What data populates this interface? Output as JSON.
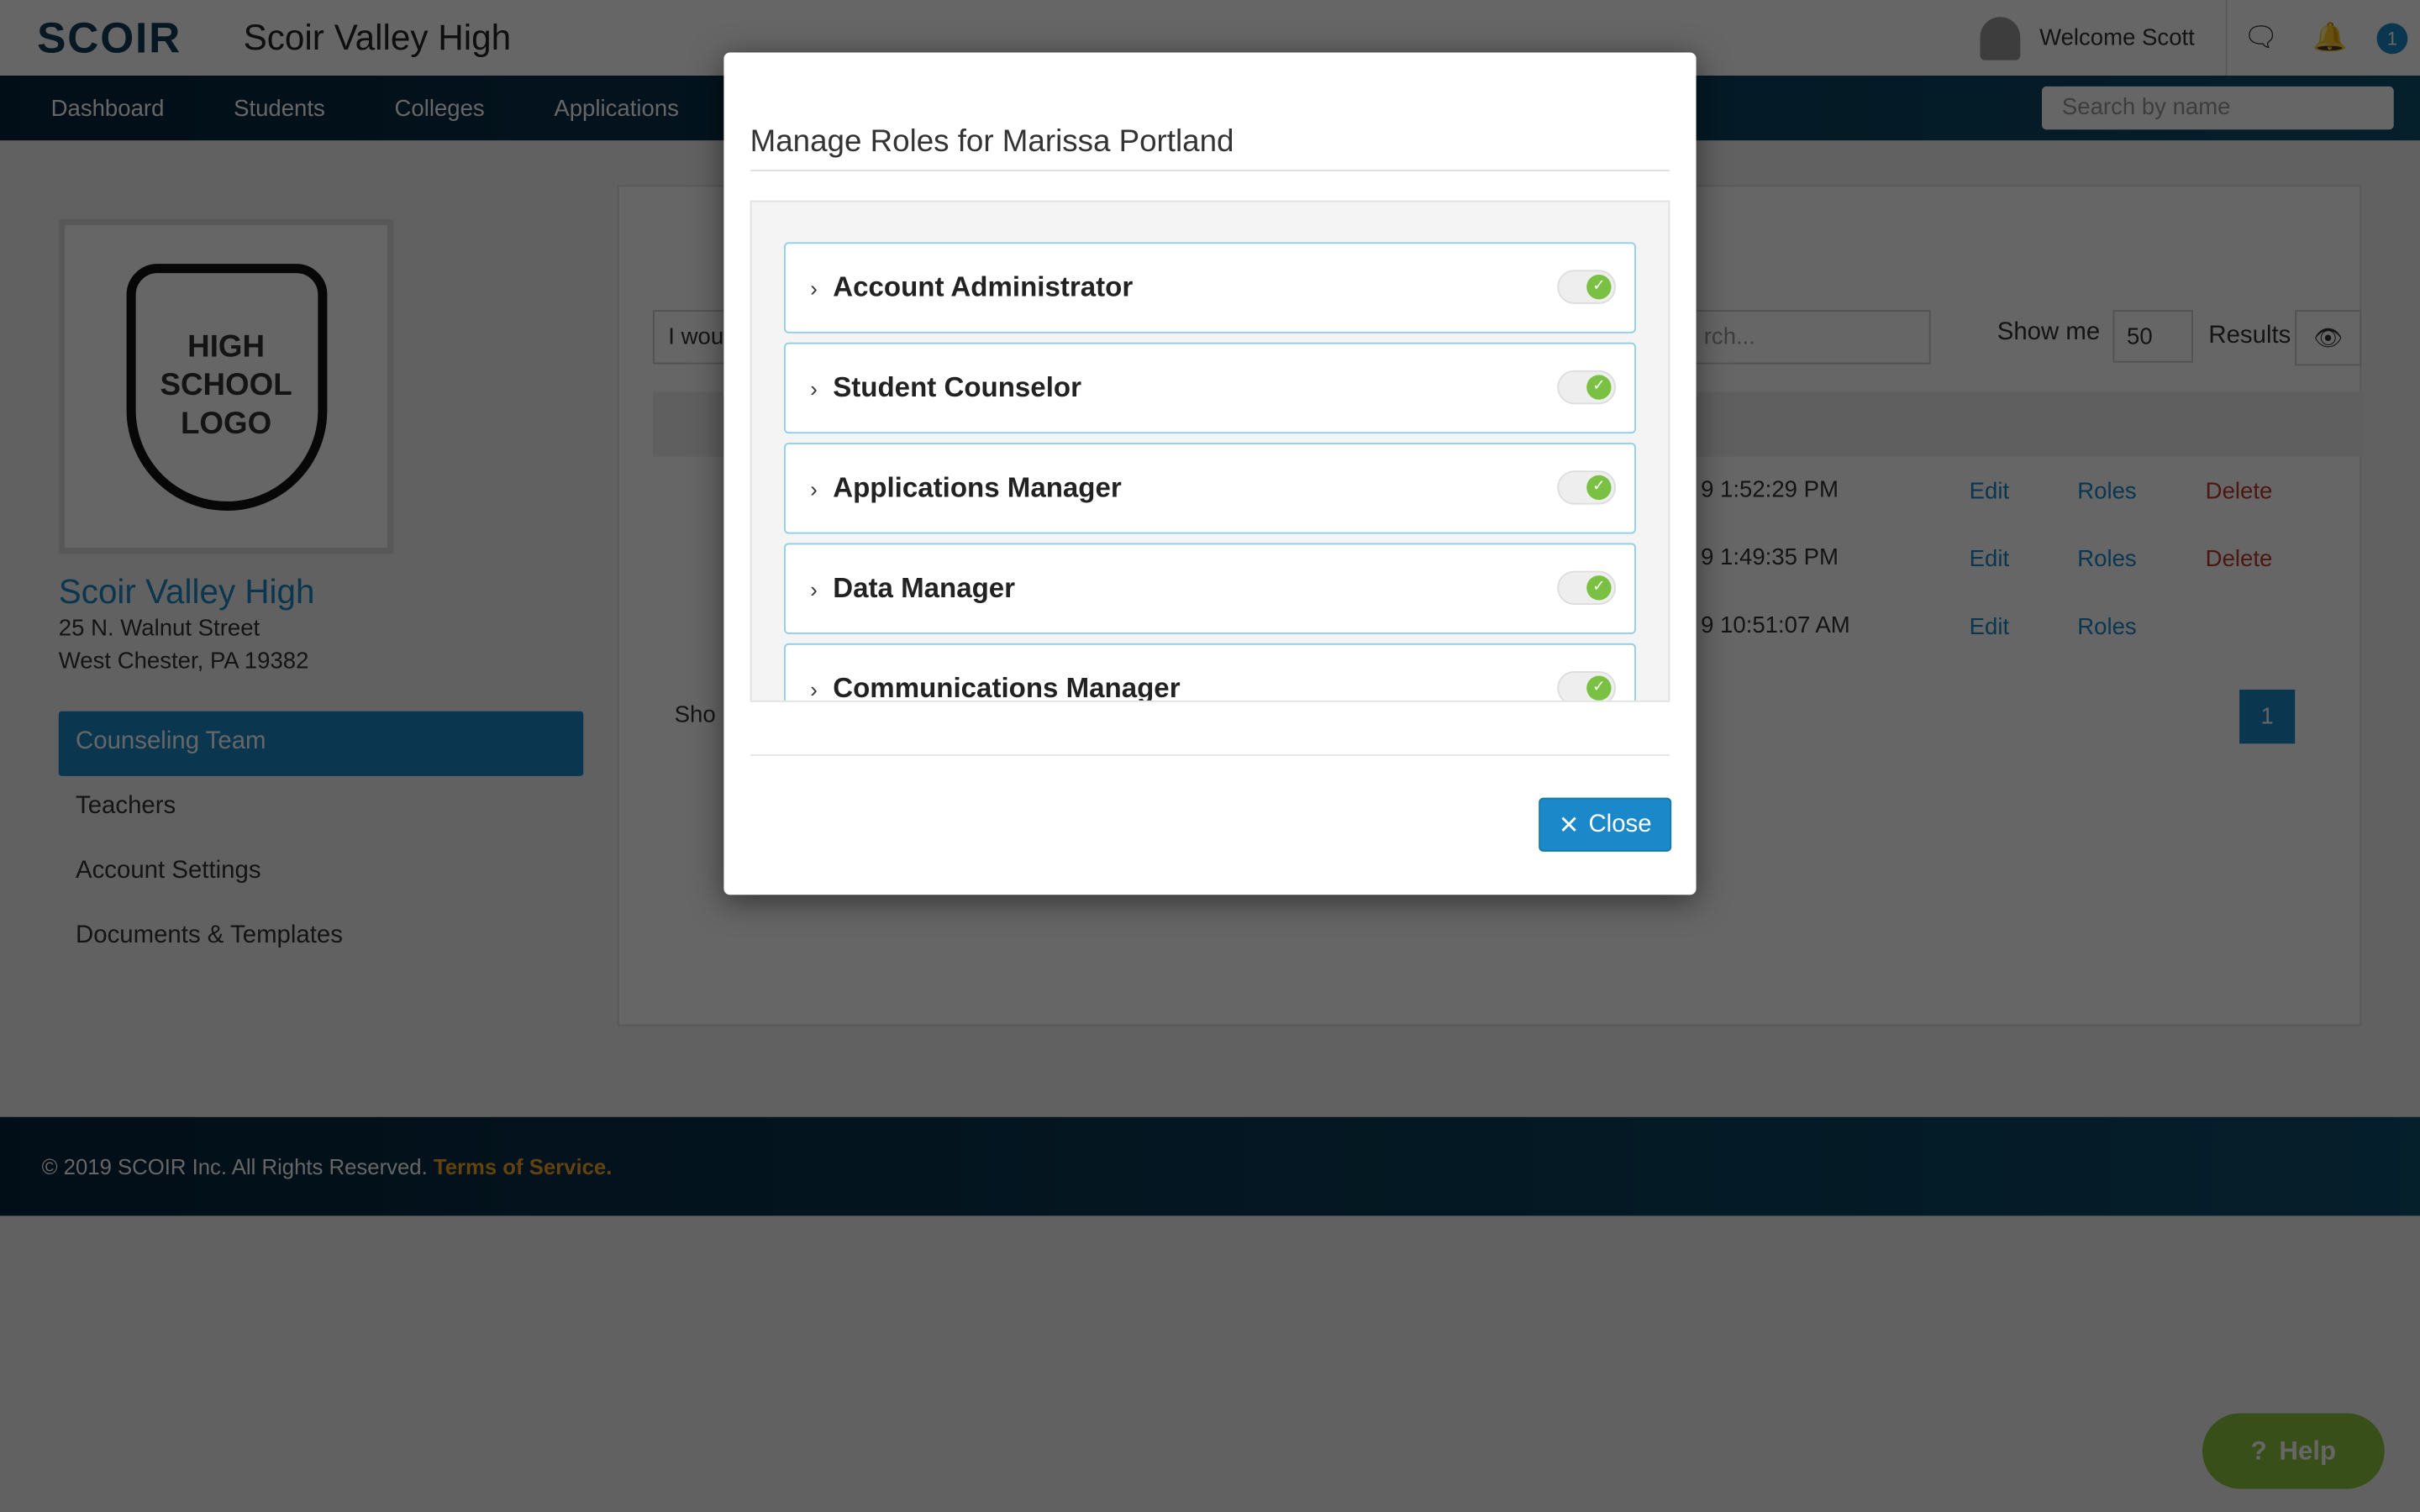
{
  "header": {
    "logo": "SCOIR",
    "school": "Scoir Valley High",
    "welcome": "Welcome Scott",
    "notification_count": "1"
  },
  "nav": {
    "items": [
      "Dashboard",
      "Students",
      "Colleges",
      "Applications"
    ],
    "search_placeholder": "Search by name"
  },
  "sidebar": {
    "logo_text": "HIGH SCHOOL LOGO",
    "school_name": "Scoir Valley High",
    "address1": "25 N. Walnut Street",
    "address2": "West Chester, PA 19382",
    "items": [
      "Counseling Team",
      "Teachers",
      "Account Settings",
      "Documents & Templates"
    ]
  },
  "main": {
    "show_me": "Show me",
    "page_size": "50",
    "results": "Results",
    "filter_value": "I wou",
    "search_placeholder": "rch...",
    "show_label": "Sho",
    "rows": [
      {
        "time": "9 1:52:29 PM",
        "actions": [
          "Edit",
          "Roles",
          "Delete"
        ]
      },
      {
        "time": "9 1:49:35 PM",
        "actions": [
          "Edit",
          "Roles",
          "Delete"
        ]
      },
      {
        "time": "9 10:51:07 AM",
        "actions": [
          "Edit",
          "Roles"
        ]
      }
    ],
    "page": "1"
  },
  "footer": {
    "copyright": "© 2019 SCOIR Inc. All Rights Reserved.",
    "terms": "Terms of Service."
  },
  "help": "Help",
  "modal": {
    "title": "Manage Roles for Marissa Portland",
    "roles": [
      {
        "label": "Account Administrator",
        "enabled": true
      },
      {
        "label": "Student Counselor",
        "enabled": true
      },
      {
        "label": "Applications Manager",
        "enabled": true
      },
      {
        "label": "Data Manager",
        "enabled": true
      },
      {
        "label": "Communications Manager",
        "enabled": true
      }
    ],
    "close": "Close"
  },
  "colors": {
    "accent": "#1a88c9",
    "toggle_on": "#7ac143",
    "help": "#8dc63f",
    "nav": "#05233a"
  }
}
